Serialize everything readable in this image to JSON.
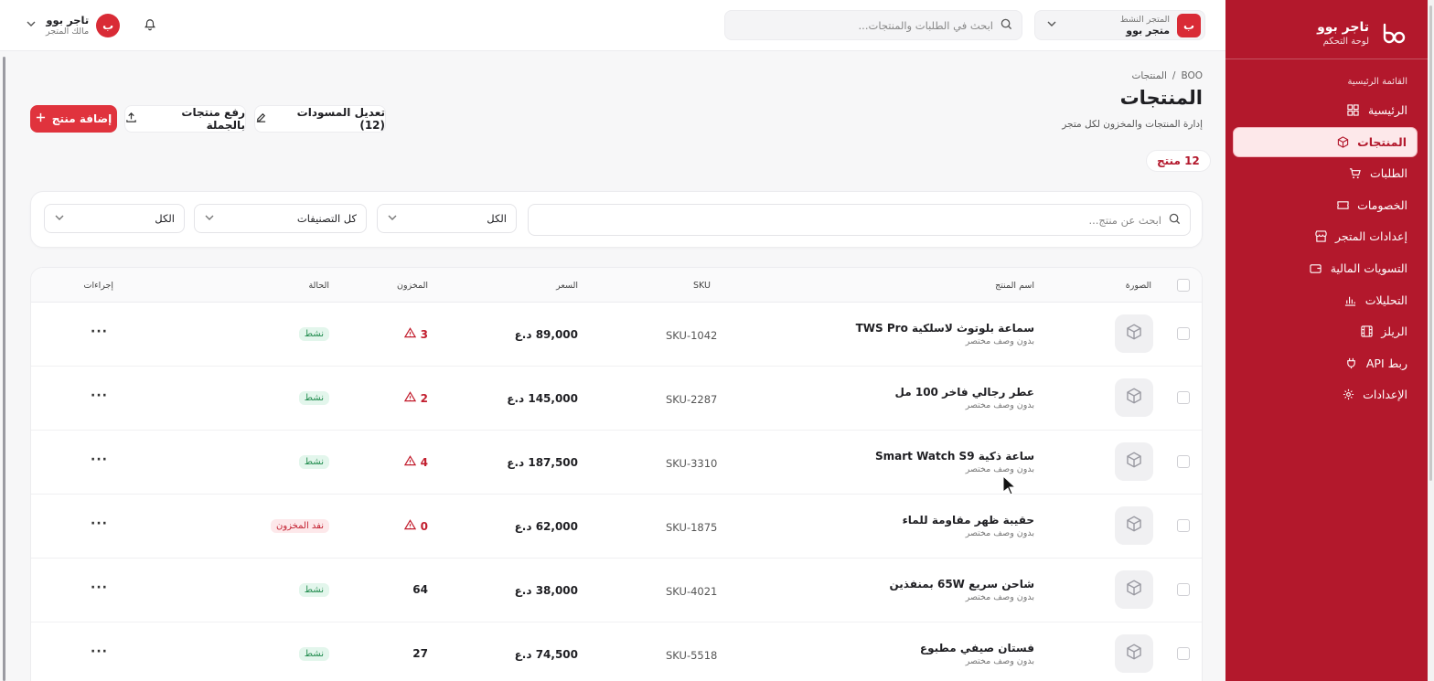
{
  "brand": {
    "name": "تاجر بوو",
    "subtitle": "لوحة التحكم"
  },
  "sidebar": {
    "section_label": "القائمة الرئيسية",
    "items": [
      {
        "label": "الرئيسية",
        "icon": "dashboard-icon",
        "active": false
      },
      {
        "label": "المنتجات",
        "icon": "box-icon",
        "active": true
      },
      {
        "label": "الطلبات",
        "icon": "cart-icon",
        "active": false
      },
      {
        "label": "الخصومات",
        "icon": "ticket-icon",
        "active": false
      },
      {
        "label": "إعدادات المتجر",
        "icon": "store-icon",
        "active": false
      },
      {
        "label": "التسويات المالية",
        "icon": "wallet-icon",
        "active": false
      },
      {
        "label": "التحليلات",
        "icon": "bar-chart-icon",
        "active": false
      },
      {
        "label": "الريلز",
        "icon": "film-icon",
        "active": false
      },
      {
        "label": "ربط API",
        "icon": "plug-icon",
        "active": false
      },
      {
        "label": "الإعدادات",
        "icon": "gear-icon",
        "active": false
      }
    ]
  },
  "topbar": {
    "store_label": "المتجر النشط",
    "store_name": "متجر بوو",
    "store_avatar": "ب",
    "search_placeholder": "ابحث في الطلبات والمنتجات...",
    "user_name": "تاجر بوو",
    "user_role": "مالك المتجر",
    "user_avatar": "ب"
  },
  "page": {
    "breadcrumb_root": "BOO",
    "breadcrumb_sep": "/",
    "breadcrumb_current": "المنتجات",
    "title": "المنتجات",
    "subtitle": "إدارة المنتجات والمخزون لكل متجر",
    "count": "12 منتج"
  },
  "actions": {
    "add_product": "إضافة منتج",
    "bulk_upload": "رفع منتجات بالجملة",
    "edit_drafts": "تعديل المسودات (12)"
  },
  "filters": {
    "search_placeholder": "ابحث عن منتج...",
    "status_value": "الكل",
    "category_value": "كل التصنيفات",
    "stock_value": "الكل"
  },
  "table": {
    "headers": {
      "image": "الصورة",
      "name": "اسم المنتج",
      "sku": "SKU",
      "price": "السعر",
      "stock": "المخزون",
      "status": "الحالة",
      "actions": "إجراءات"
    },
    "rows": [
      {
        "name": "سماعة بلوتوث لاسلكية TWS Pro",
        "desc": "بدون وصف مختصر",
        "sku": "SKU-1042",
        "price": "89,000 د.ع",
        "stock": "3",
        "low": true,
        "status": "نشط",
        "status_type": "active"
      },
      {
        "name": "عطر رجالي فاخر 100 مل",
        "desc": "بدون وصف مختصر",
        "sku": "SKU-2287",
        "price": "145,000 د.ع",
        "stock": "2",
        "low": true,
        "status": "نشط",
        "status_type": "active"
      },
      {
        "name": "ساعة ذكية Smart Watch S9",
        "desc": "بدون وصف مختصر",
        "sku": "SKU-3310",
        "price": "187,500 د.ع",
        "stock": "4",
        "low": true,
        "status": "نشط",
        "status_type": "active"
      },
      {
        "name": "حقيبة ظهر مقاومة للماء",
        "desc": "بدون وصف مختصر",
        "sku": "SKU-1875",
        "price": "62,000 د.ع",
        "stock": "0",
        "low": true,
        "status": "نفد المخزون",
        "status_type": "out"
      },
      {
        "name": "شاحن سريع 65W بمنفذين",
        "desc": "بدون وصف مختصر",
        "sku": "SKU-4021",
        "price": "38,000 د.ع",
        "stock": "64",
        "low": false,
        "status": "نشط",
        "status_type": "active"
      },
      {
        "name": "فستان صيفي مطبوع",
        "desc": "بدون وصف مختصر",
        "sku": "SKU-5518",
        "price": "74,500 د.ع",
        "stock": "27",
        "low": false,
        "status": "نشط",
        "status_type": "active"
      }
    ],
    "more_label": "···"
  },
  "colors": {
    "brand": "#b3182c",
    "primary_button": "#e0333d",
    "low_stock": "#c21e2e",
    "active_badge": "#1f8a4c"
  }
}
